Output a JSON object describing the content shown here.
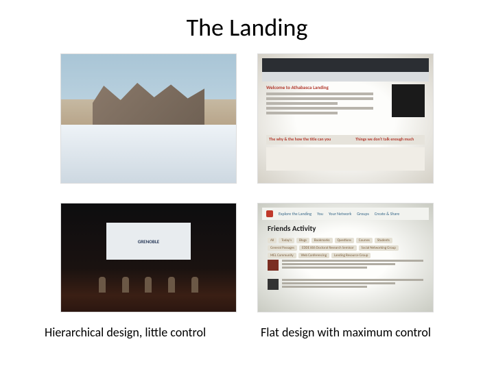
{
  "title": "The Landing",
  "captions": {
    "left": "Hierarchical design, little control",
    "right": "Flat design with maximum control"
  },
  "topright": {
    "welcome": "Welcome to Athabasca Landing",
    "link1": "The why & the how the title can you",
    "link2": "Things we don't talk enough much"
  },
  "bottomleft": {
    "screen_text": "GRENOBLE"
  },
  "bottomright": {
    "tabs": [
      "Explore the Landing",
      "You",
      "Your Network",
      "Groups",
      "Create & Share"
    ],
    "heading": "Friends Activity",
    "chips": [
      "All",
      "Today's",
      "Blogs",
      "Bookmarks",
      "Questions",
      "Courses",
      "Students"
    ],
    "chips2": [
      "General Passages",
      "EDDE 806 Doctoral Research Seminar",
      "Social Networking Group"
    ],
    "chips3": [
      "MEL Community",
      "Web Conferencing",
      "Landing Resource Group"
    ]
  }
}
